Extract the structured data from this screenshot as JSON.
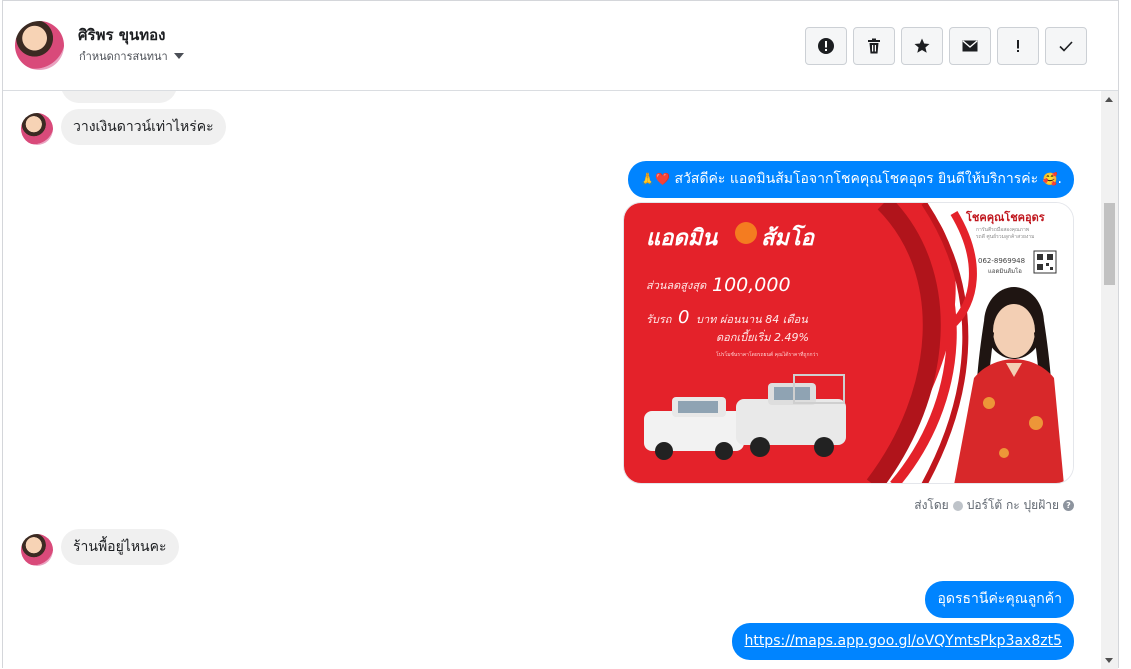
{
  "header": {
    "contact_name": "ศิริพร ขุนทอง",
    "assign_label": "กำหนดการสนทนา",
    "actions": [
      {
        "name": "spam-icon",
        "glyph": "!"
      },
      {
        "name": "trash-icon",
        "glyph": ""
      },
      {
        "name": "star-icon",
        "glyph": ""
      },
      {
        "name": "mail-icon",
        "glyph": ""
      },
      {
        "name": "important-icon",
        "glyph": "!"
      },
      {
        "name": "check-icon",
        "glyph": ""
      }
    ]
  },
  "messages": {
    "in1": "วางเงินดาวน์เท่าไหร่คะ",
    "out1_text": "สวัสดีค่ะ แอดมินส้มโอจากโชคคุณโชคอุดร ยินดีให้บริการค่ะ",
    "out1_prefix_emoji": "🙏❤️",
    "out1_suffix_emoji": "🥰",
    "out1_end": ".",
    "in2": "ร้านพื้อยู่ไหนคะ",
    "out2": "อุดรธานีค่ะคุณลูกค้า",
    "out3_link": "https://maps.app.goo.gl/oVQYmtsPkp3ax8zt5"
  },
  "promo": {
    "brand": "แอดมิน",
    "brand2": "ส้มโอ",
    "discount_label": "ส่วนลดสูงสุด",
    "discount_value": "100,000",
    "down_label": "รับรถ",
    "down_value": "0",
    "down_rest": "บาท ผ่อนนาน 84 เดือน",
    "interest": "ดอกเบี้ยเริ่ม 2.49%",
    "fine_print": "โปรโมชั่นราคาโดยรถยนต์ คุณได้ราคาที่ถูกกว่า",
    "shop_name": "โชคคุณโชคอุดร",
    "shop_sub": "การันตีรถมือสองคุณภาพ",
    "shop_sub2": "รถดี ศูนย์รวมลูกค้าสวยงาม",
    "phone": "062-8969948",
    "phone_label": "แอดมินส้มโอ"
  },
  "sent_by": {
    "prefix": "ส่งโดย",
    "name": "ปอร์โต้ กะ ปุยฝ้าย"
  },
  "colors": {
    "brand_blue": "#0084ff",
    "promo_red": "#e4222a"
  }
}
